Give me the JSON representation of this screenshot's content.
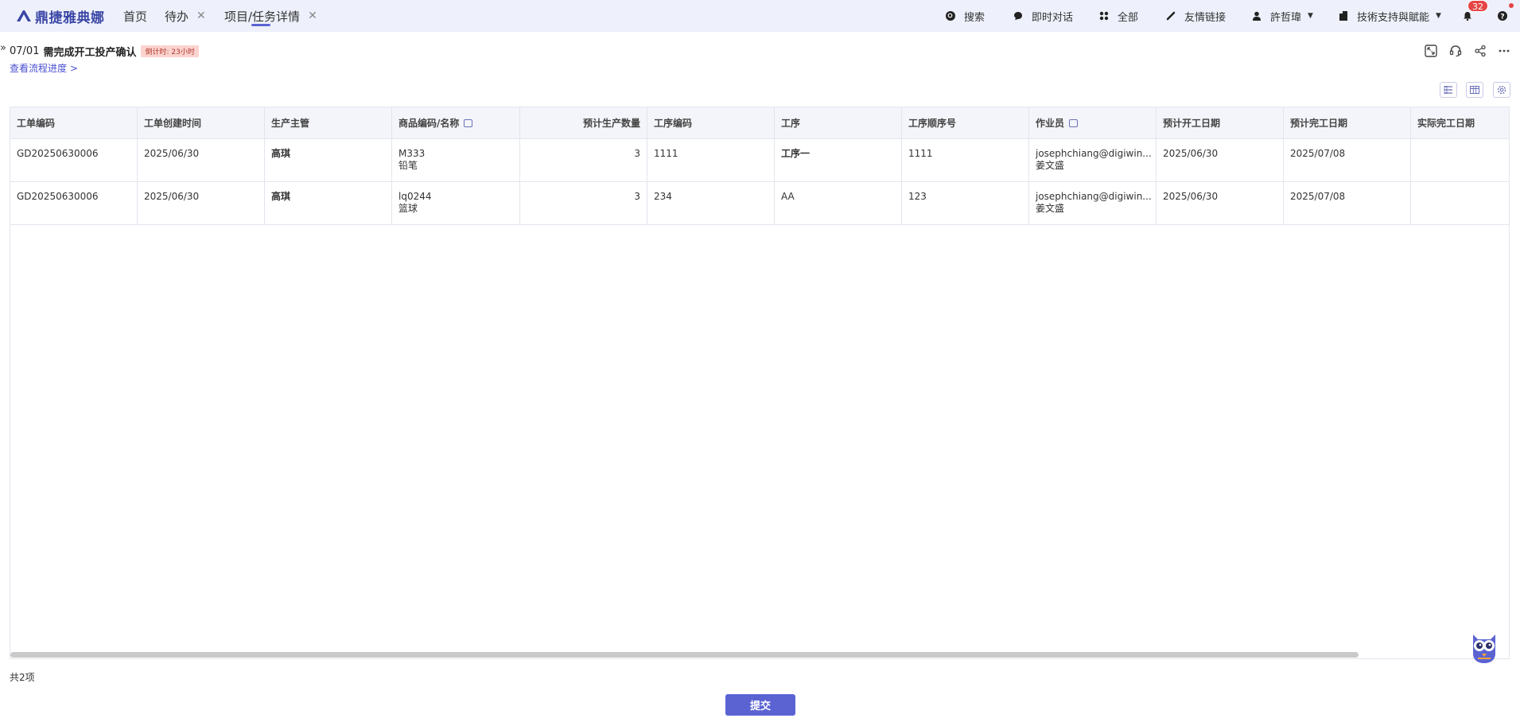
{
  "app": {
    "name": "鼎捷雅典娜"
  },
  "tabs": [
    {
      "label": "首页",
      "closable": false
    },
    {
      "label": "待办",
      "closable": true
    },
    {
      "label": "项目/任务详情",
      "closable": true,
      "active": true
    }
  ],
  "nav": {
    "search": "搜索",
    "chat": "即时对话",
    "all": "全部",
    "links": "友情链接",
    "user": "許哲瑋",
    "tenant": "技術支持與賦能",
    "notification_count": "32"
  },
  "task": {
    "date": "07/01",
    "title": "需完成开工投产确认",
    "deadline": "倒计时: 23小时",
    "process_link": "查看流程进度 >"
  },
  "table": {
    "columns": [
      "工单编码",
      "工单创建时间",
      "生产主管",
      "商品编码/名称",
      "预计生产数量",
      "工序编码",
      "工序",
      "工序顺序号",
      "作业员",
      "预计开工日期",
      "预计完工日期",
      "实际完工日期"
    ],
    "rows": [
      {
        "order_no": "GD20250630006",
        "created": "2025/06/30",
        "supervisor": "高琪",
        "item_code": "M333",
        "item_name": "铅笔",
        "qty": "3",
        "op_code": "1111",
        "op": "工序一",
        "op_seq": "1111",
        "worker_email": "josephchiang@digiwin...",
        "worker_name": "姜文盛",
        "start": "2025/06/30",
        "end": "2025/07/08",
        "actual_end": ""
      },
      {
        "order_no": "GD20250630006",
        "created": "2025/06/30",
        "supervisor": "高琪",
        "item_code": "lq0244",
        "item_name": "篮球",
        "qty": "3",
        "op_code": "234",
        "op": "AA",
        "op_seq": "123",
        "worker_email": "josephchiang@digiwin...",
        "worker_name": "姜文盛",
        "start": "2025/06/30",
        "end": "2025/07/08",
        "actual_end": ""
      }
    ],
    "total": "共2项"
  },
  "submit_label": "提交",
  "colors": {
    "accent": "#5b63d3",
    "topbar_bg": "#eef1fb",
    "badge": "#e64545"
  }
}
